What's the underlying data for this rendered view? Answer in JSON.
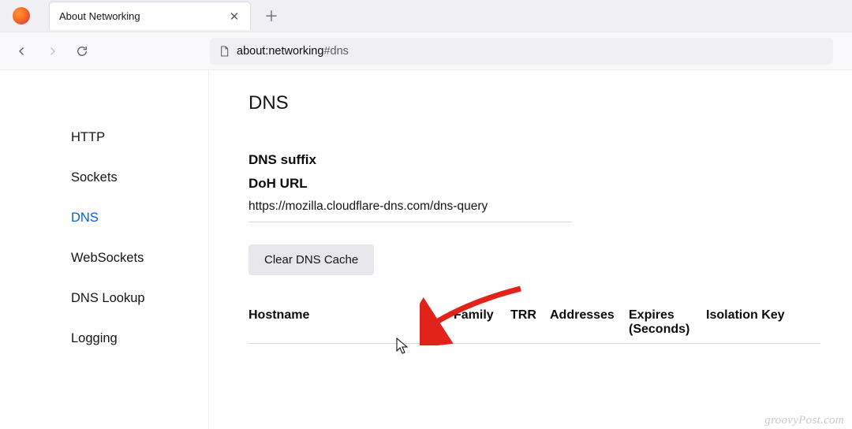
{
  "tab": {
    "title": "About Networking"
  },
  "urlbar": {
    "scheme": "about:networking",
    "fragment": "#dns"
  },
  "sidebar": {
    "items": [
      {
        "label": "HTTP"
      },
      {
        "label": "Sockets"
      },
      {
        "label": "DNS"
      },
      {
        "label": "WebSockets"
      },
      {
        "label": "DNS Lookup"
      },
      {
        "label": "Logging"
      }
    ]
  },
  "main": {
    "heading": "DNS",
    "suffix_label": "DNS suffix",
    "doh_label": "DoH URL",
    "doh_url": "https://mozilla.cloudflare-dns.com/dns-query",
    "clear_button": "Clear DNS Cache",
    "columns": {
      "hostname": "Hostname",
      "family": "Family",
      "trr": "TRR",
      "addresses": "Addresses",
      "expires": "Expires (Seconds)",
      "isolation": "Isolation Key"
    }
  },
  "watermark": "groovyPost.com"
}
